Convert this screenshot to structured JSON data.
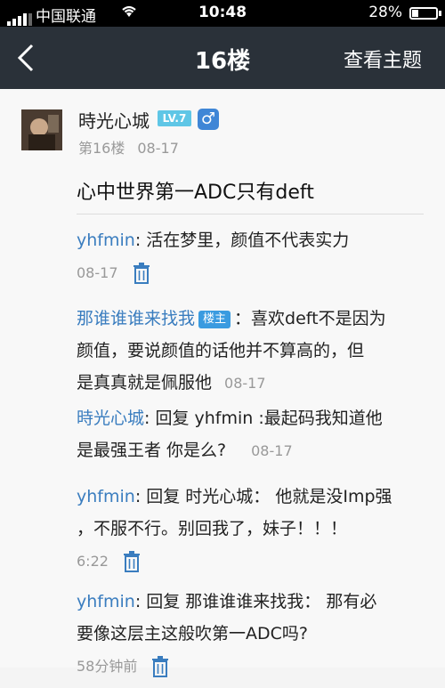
{
  "status_bar": {
    "carrier": "中国联通",
    "time": "10:48",
    "battery": "28%"
  },
  "nav": {
    "title": "16楼",
    "view_topic": "查看主题"
  },
  "post": {
    "username": "時光心城",
    "level_badge": "LV.7",
    "gender_symbol": "♂",
    "floor": "第16楼",
    "date": "08-17",
    "content": "心中世界第一ADC只有deft"
  },
  "replies": [
    {
      "lines": [
        {
          "author": "yhfmin",
          "colon": ": ",
          "text": "活在梦里，颜值不代表实力"
        }
      ],
      "time": "08-17",
      "deletable": true
    },
    {
      "lines": [
        {
          "author": "那谁谁谁来找我",
          "host_badge": "楼主",
          "colon": "：",
          "text": "喜欢deft不是因为"
        },
        {
          "text": "颜值，要说颜值的话他并不算高的，但"
        },
        {
          "text": "是真真就是佩服他"
        }
      ],
      "time": "08-17",
      "deletable": false
    },
    {
      "lines": [
        {
          "author": "時光心城",
          "colon": ": ",
          "text": "回复 yhfmin :最起码我知道他"
        },
        {
          "text": "是最强王者 你是么?"
        }
      ],
      "time": "08-17",
      "deletable": false
    },
    {
      "lines": [
        {
          "author": "yhfmin",
          "colon": ": ",
          "text": "回复 时光心城： 他就是没Imp强"
        },
        {
          "text": "，不服不行。别回我了，妹子！！！"
        }
      ],
      "time": "6:22",
      "deletable": true
    },
    {
      "lines": [
        {
          "author": "yhfmin",
          "colon": ": ",
          "text": "回复 那谁谁谁来找我： 那有必"
        },
        {
          "text": "要像这层主这般吹第一ADC吗?"
        }
      ],
      "time": "58分钟前",
      "deletable": true
    }
  ]
}
